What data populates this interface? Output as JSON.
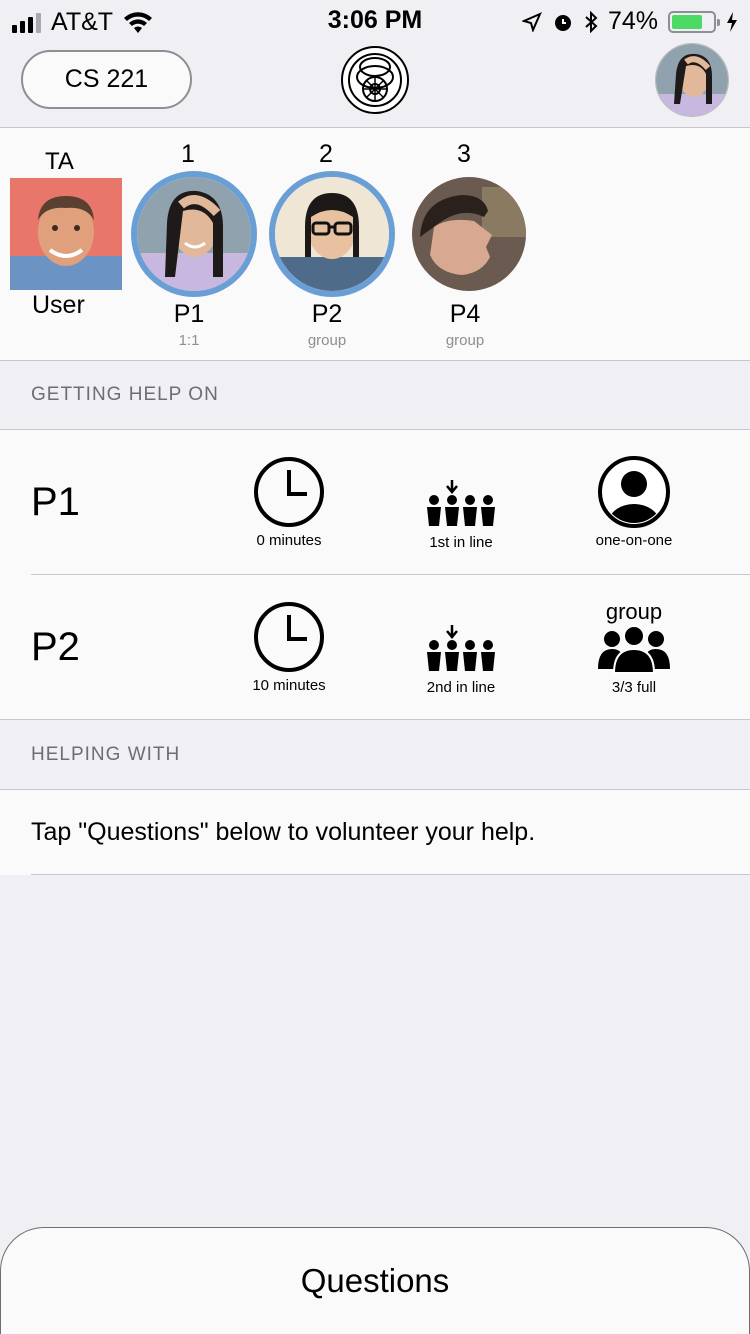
{
  "status_bar": {
    "carrier": "AT&T",
    "time": "3:06 PM",
    "battery": "74%",
    "battery_level": 0.74
  },
  "nav": {
    "course": "CS 221"
  },
  "queue": {
    "ta_label": "TA",
    "user_label": "User",
    "people": [
      {
        "position": "1",
        "name": "P1",
        "type": "1:1"
      },
      {
        "position": "2",
        "name": "P2",
        "type": "group"
      },
      {
        "position": "3",
        "name": "P4",
        "type": "group"
      }
    ]
  },
  "getting_help": {
    "header": "GETTING HELP ON",
    "rows": [
      {
        "name": "P1",
        "wait": "0 minutes",
        "line": "1st in line",
        "mode": "one-on-one",
        "mode_top": "",
        "mode_icon": "single-person-icon"
      },
      {
        "name": "P2",
        "wait": "10 minutes",
        "line": "2nd in line",
        "mode": "3/3 full",
        "mode_top": "group",
        "mode_icon": "group-icon"
      }
    ]
  },
  "helping_with": {
    "header": "HELPING WITH",
    "text": "Tap \"Questions\" below to volunteer your help."
  },
  "bottom": {
    "questions_label": "Questions"
  },
  "colors": {
    "ring": "#6a9fd6",
    "battery": "#4cd964",
    "background": "#efeff4"
  }
}
